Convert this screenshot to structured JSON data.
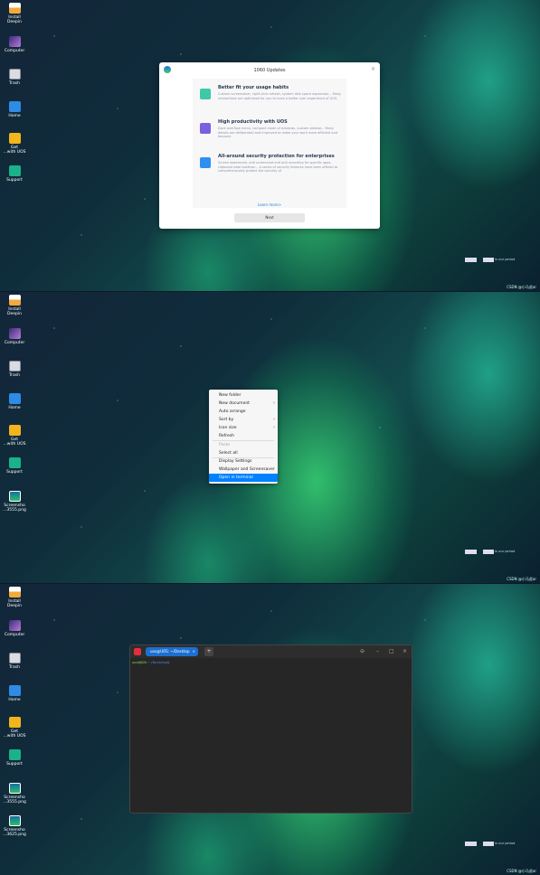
{
  "desktop_icons": {
    "install": "Install\nDeepin",
    "computer": "Computer",
    "trash": "Trash",
    "home": "Home",
    "get": "Get\n...with UOS",
    "support": "Support",
    "screenshot1": "Screensho\n...3555.png",
    "screenshot2": "Screensho\n...3625.png"
  },
  "dialog": {
    "title": "1060 Updates",
    "close": "×",
    "features": [
      {
        "heading": "Better fit your usage habits",
        "desc": "Custom screensaver, right-click refresh, system disk space expansion... Many interactions are optimized for you to have a better user experience of UOS.",
        "color": "#3fc8a6"
      },
      {
        "heading": "High productivity with UOS",
        "desc": "Dock overflow menu, compact mode of windows, custom sidebar... Many details are deliberated and improved to make your work more efficient and focused.",
        "color": "#7a5fe0"
      },
      {
        "heading": "All-around security protection for enterprises",
        "desc": "Screen watermark, anti screenshot and anti recording for specific apps, clipboard data isolation... A series of security features have been offered to comprehensively protect the security of",
        "color": "#2f8ff0"
      }
    ],
    "learn_more": "Learn more>",
    "next": "Next"
  },
  "context_menu": {
    "items": [
      "New folder",
      "New document",
      "Auto arrange",
      "Sort by",
      "Icon size",
      "Refresh",
      "Paste",
      "Select all",
      "Display Settings",
      "Wallpaper and Screensaver",
      "Open in terminal"
    ]
  },
  "terminal": {
    "tab_title": "uos@UOS: ~/Desktop",
    "tab_close": "×",
    "add_tab": "+",
    "btn_menu": "⊖",
    "btn_min": "–",
    "btn_max": "□",
    "btn_close": "×",
    "prompt_user": "uos@UOS",
    "prompt_path": ":~/Desktop$"
  },
  "tray_text": "in our period",
  "watermark": "CSDN @小马虎ar"
}
